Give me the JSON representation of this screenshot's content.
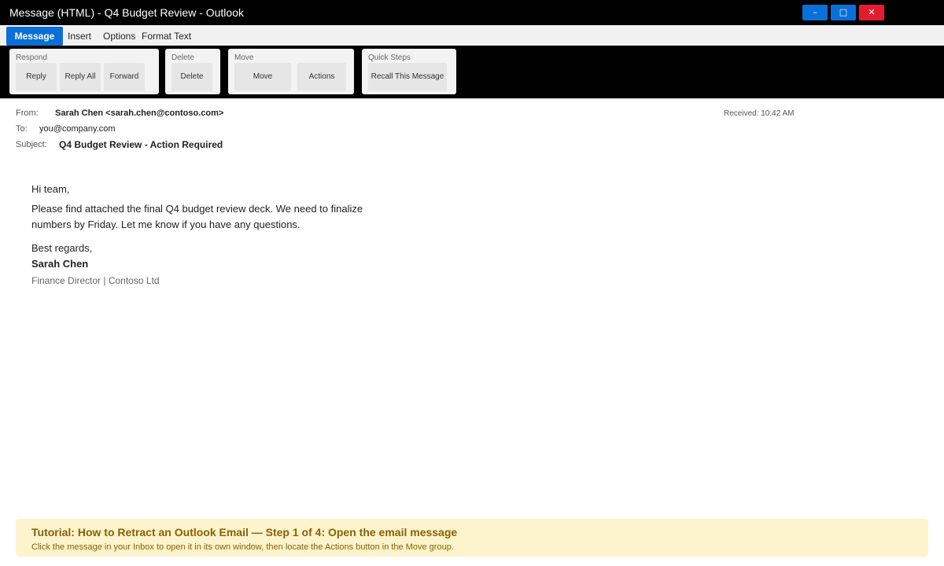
{
  "window": {
    "title": "Message (HTML) - Q4 Budget Review - Outlook",
    "controls": {
      "minimize": "–",
      "maximize": "□",
      "close": "✕"
    }
  },
  "tabs": [
    {
      "label": "Message",
      "active": true
    },
    {
      "label": "Insert"
    },
    {
      "label": "Options"
    },
    {
      "label": "Format Text"
    }
  ],
  "ribbon": {
    "respond": {
      "label": "Respond",
      "buttons": [
        "Reply",
        "Reply All",
        "Forward"
      ]
    },
    "delete": {
      "label": "Delete",
      "buttons": [
        "Delete"
      ]
    },
    "move": {
      "label": "Move",
      "buttons": [
        "Move",
        "Actions"
      ]
    },
    "quick_steps": {
      "label": "Quick Steps",
      "buttons": [
        "Recall This Message"
      ]
    }
  },
  "message": {
    "from_label": "From:",
    "from_value": "Sarah Chen <sarah.chen@contoso.com>",
    "to_label": "To:",
    "to_value": "you@company.com",
    "subject_label": "Subject:",
    "subject_value": "Q4 Budget Review - Action Required",
    "received": "Received: 10:42 AM",
    "greeting": "Hi team,",
    "body_line1": "Please find attached the final Q4 budget review deck. We need to finalize",
    "body_line2": "numbers by Friday. Let me know if you have any questions.",
    "closing": "Best regards,",
    "signature_name": "Sarah Chen",
    "signature_role": "Finance Director | Contoso Ltd"
  },
  "tutorial": {
    "title": "Tutorial: How to Retract an Outlook Email — Step 1 of 4: Open the email message",
    "description": "Click the message in your Inbox to open it in its own window, then locate the Actions button in the Move group."
  },
  "colors": {
    "accent": "#0a6fd6",
    "close": "#e11d2f",
    "ribbon_bg": "#000000",
    "tutorial_bg": "#fdf3cd",
    "tutorial_text": "#8a6100"
  }
}
